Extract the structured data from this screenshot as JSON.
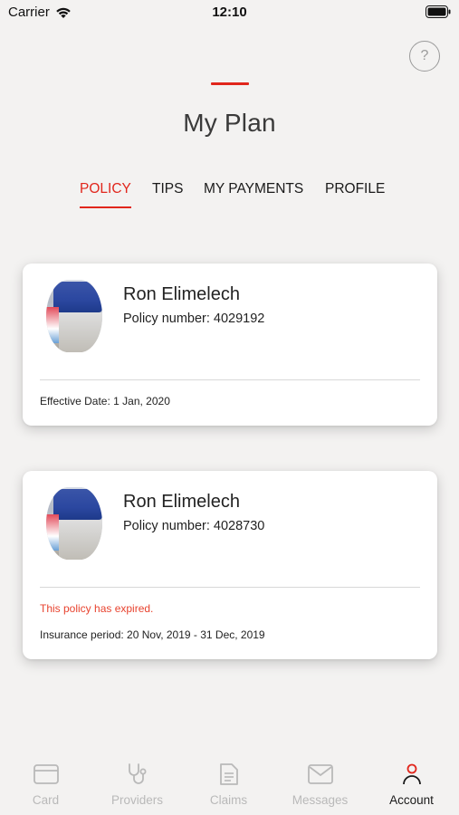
{
  "status_bar": {
    "carrier": "Carrier",
    "time": "12:10"
  },
  "header": {
    "help_label": "?",
    "title": "My Plan",
    "accent_color": "#e1261c"
  },
  "tabs": [
    {
      "label": "POLICY",
      "active": true
    },
    {
      "label": "TIPS",
      "active": false
    },
    {
      "label": "MY PAYMENTS",
      "active": false
    },
    {
      "label": "PROFILE",
      "active": false
    }
  ],
  "policies": [
    {
      "holder": "Ron Elimelech",
      "number_label": "Policy number:",
      "number": "4029192",
      "status_note": "",
      "meta": "Effective Date: 1 Jan, 2020"
    },
    {
      "holder": "Ron Elimelech",
      "number_label": "Policy number:",
      "number": "4028730",
      "status_note": "This policy has expired.",
      "status_note_color": "#e8432f",
      "meta": "Insurance period: 20 Nov, 2019 - 31 Dec, 2019"
    }
  ],
  "tabbar": [
    {
      "label": "Card",
      "icon": "card-icon",
      "active": false
    },
    {
      "label": "Providers",
      "icon": "stethoscope-icon",
      "active": false
    },
    {
      "label": "Claims",
      "icon": "document-icon",
      "active": false
    },
    {
      "label": "Messages",
      "icon": "envelope-icon",
      "active": false
    },
    {
      "label": "Account",
      "icon": "person-icon",
      "active": true
    }
  ]
}
